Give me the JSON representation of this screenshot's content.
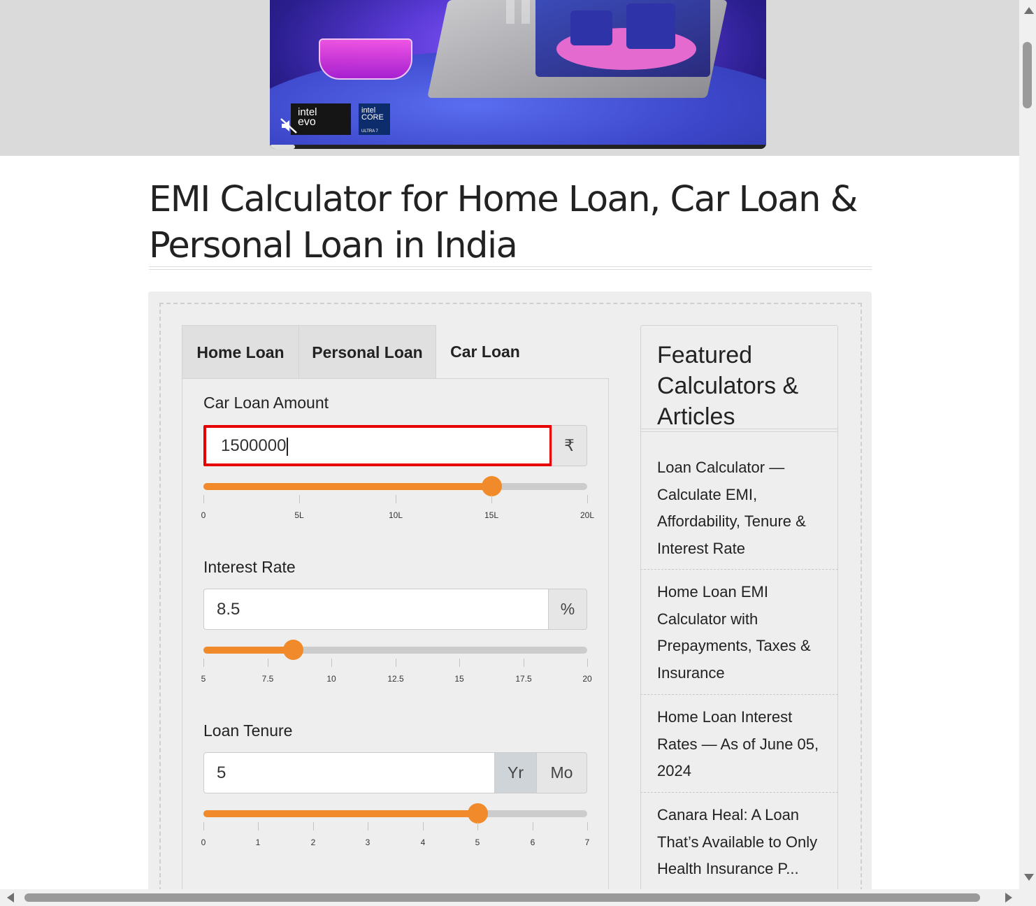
{
  "ad": {
    "badge_evo_top": "intel",
    "badge_evo_bottom": "evo",
    "badge_core_top": "intel",
    "badge_core_mid": "CORE",
    "badge_core_bottom": "ULTRA 7"
  },
  "page_title": "EMI Calculator for Home Loan, Car Loan & Personal Loan in India",
  "tabs": [
    {
      "label": "Home Loan",
      "active": false
    },
    {
      "label": "Personal Loan",
      "active": false
    },
    {
      "label": "Car Loan",
      "active": true
    }
  ],
  "loan_amount": {
    "label": "Car Loan Amount",
    "value": "1500000",
    "unit": "₹",
    "slider_fraction": 0.75,
    "ticks": [
      "0",
      "5L",
      "10L",
      "15L",
      "20L"
    ]
  },
  "interest_rate": {
    "label": "Interest Rate",
    "value": "8.5",
    "unit": "%",
    "slider_fraction": 0.2333,
    "ticks": [
      "5",
      "7.5",
      "10",
      "12.5",
      "15",
      "17.5",
      "20"
    ]
  },
  "loan_tenure": {
    "label": "Loan Tenure",
    "value": "5",
    "unit_year": "Yr",
    "unit_month": "Mo",
    "selected_unit": "Yr",
    "slider_fraction": 0.7143,
    "ticks": [
      "0",
      "1",
      "2",
      "3",
      "4",
      "5",
      "6",
      "7"
    ]
  },
  "sidebar": {
    "title": "Featured Calculators & Articles",
    "links": [
      "Loan Calculator — Calculate EMI, Affordability, Tenure & Interest Rate",
      "Home Loan EMI Calculator with Prepayments, Taxes & Insurance",
      "Home Loan Interest Rates — As of June 05, 2024",
      "Canara Heal: A Loan That’s Available to Only Health Insurance P..."
    ]
  },
  "colors": {
    "accent": "#f08a2b",
    "focus_border": "#e60000",
    "panel_bg": "#eeeeee"
  }
}
